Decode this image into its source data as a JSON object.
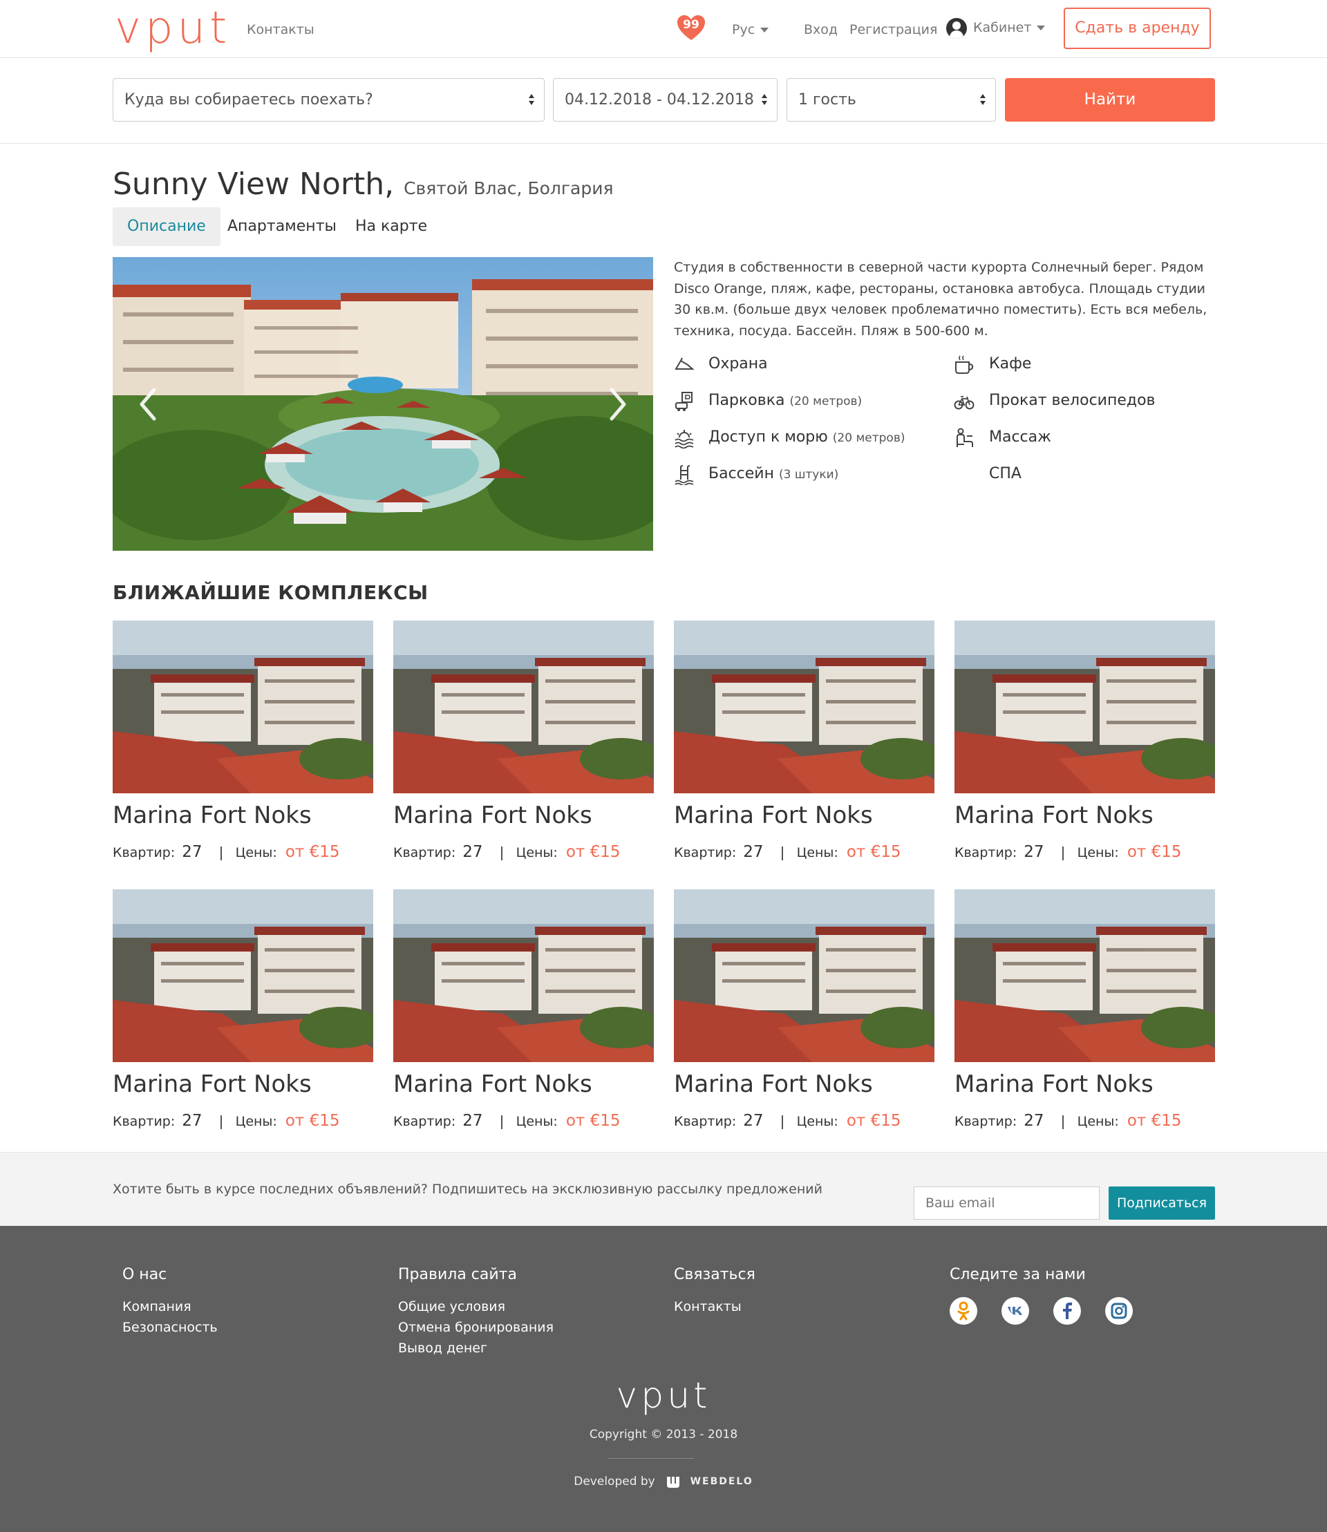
{
  "header": {
    "logo": "vput",
    "contacts": "Контакты",
    "favorites_count": "99",
    "language": "Рус",
    "login": "Вход",
    "register": "Регистрация",
    "cabinet": "Кабинет",
    "rent_button": "Сдать в аренду"
  },
  "search": {
    "destination": "Куда вы собираетесь поехать?",
    "dates": "04.12.2018 - 04.12.2018",
    "guests": "1 гость",
    "find_button": "Найти"
  },
  "property": {
    "name": "Sunny View North,",
    "location": "Святой Влас, Болгария",
    "tabs": [
      "Описание",
      "Апартаменты",
      "На карте"
    ],
    "description": "Студия в собственности в северной части курорта Солнечный берег. Рядом Disco Orange, пляж, кафе, рестораны, остановка автобуса. Площадь студии 30 кв.м. (больше двух человек проблематично поместить). Есть вся мебель, техника, посуда. Бассейн. Пляж в 500-600 м.",
    "amenities_left": [
      {
        "label": "Охрана",
        "note": "",
        "icon": "security-icon"
      },
      {
        "label": "Парковка",
        "note": "(20 метров)",
        "icon": "parking-icon"
      },
      {
        "label": "Доступ к морю",
        "note": "(20 метров)",
        "icon": "sea-icon"
      },
      {
        "label": "Бассейн",
        "note": "(3 штуки)",
        "icon": "pool-icon"
      }
    ],
    "amenities_right": [
      {
        "label": "Кафе",
        "icon": "cafe-icon"
      },
      {
        "label": "Прокат велосипедов",
        "icon": "bicycle-icon"
      },
      {
        "label": "Массаж",
        "icon": "massage-icon"
      },
      {
        "label": "СПА",
        "icon": ""
      }
    ]
  },
  "nearby": {
    "heading": "БЛИЖАЙШИЕ КОМПЛЕКСЫ",
    "flats_label": "Квартир:",
    "price_label": "Цены:",
    "items": [
      {
        "name": "Marina Fort Noks",
        "flats": "27",
        "price": "от €15"
      },
      {
        "name": "Marina Fort Noks",
        "flats": "27",
        "price": "от €15"
      },
      {
        "name": "Marina Fort Noks",
        "flats": "27",
        "price": "от €15"
      },
      {
        "name": "Marina Fort Noks",
        "flats": "27",
        "price": "от €15"
      },
      {
        "name": "Marina Fort Noks",
        "flats": "27",
        "price": "от €15"
      },
      {
        "name": "Marina Fort Noks",
        "flats": "27",
        "price": "от €15"
      },
      {
        "name": "Marina Fort Noks",
        "flats": "27",
        "price": "от €15"
      },
      {
        "name": "Marina Fort Noks",
        "flats": "27",
        "price": "от €15"
      }
    ]
  },
  "subscribe": {
    "text": "Хотите быть в курсе последних объявлений? Подпишитесь на эксклюзивную рассылку предложений",
    "email_placeholder": "Ваш email",
    "button": "Подписаться"
  },
  "footer": {
    "about": {
      "title": "О нас",
      "links": [
        "Компания",
        "Безопасность"
      ]
    },
    "rules": {
      "title": "Правила сайта",
      "links": [
        "Общие условия",
        "Отмена бронирования",
        "Вывод денег"
      ]
    },
    "contact": {
      "title": "Связаться",
      "links": [
        "Контакты"
      ]
    },
    "follow": {
      "title": "Следите за нами",
      "networks": [
        "odnoklassniki-icon",
        "vk-icon",
        "facebook-icon",
        "instagram-icon"
      ]
    },
    "logo": "vput",
    "copyright": "Copyright © 2013 - 2018",
    "developed_by": "Developed by",
    "developer": "WEBDELO"
  },
  "colors": {
    "accent": "#f26a51",
    "button": "#f96a4d",
    "teal": "#138e9d",
    "footer": "#5f5f5f"
  }
}
